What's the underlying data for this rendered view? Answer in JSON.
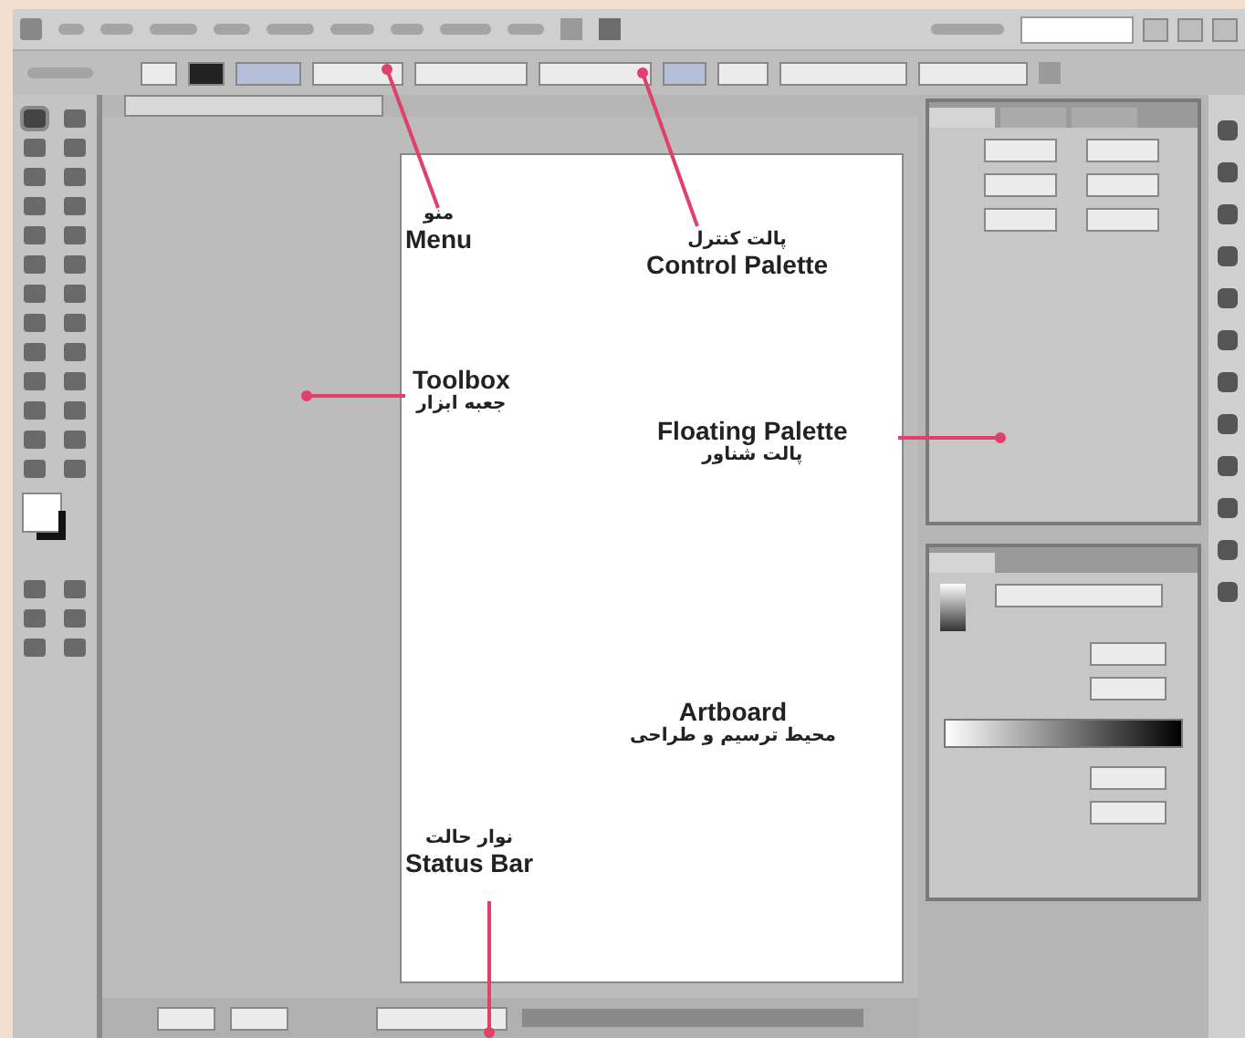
{
  "callouts": [
    {
      "lines": [
        {
          "text": "منو",
          "kind": "persian"
        },
        {
          "text": "Menu",
          "kind": "english"
        }
      ]
    },
    {
      "lines": [
        {
          "text": "پالت کنترل",
          "kind": "persian"
        },
        {
          "text": "Control Palette",
          "kind": "english"
        }
      ]
    },
    {
      "lines": [
        {
          "text": "Toolbox",
          "kind": "english"
        },
        {
          "text": "جعبه ابزار",
          "kind": "persian"
        }
      ]
    },
    {
      "lines": [
        {
          "text": "Floating Palette",
          "kind": "english"
        },
        {
          "text": "پالت شناور",
          "kind": "persian"
        }
      ]
    },
    {
      "lines": [
        {
          "text": "Artboard",
          "kind": "english"
        },
        {
          "text": "محیط ترسیم و طراحی",
          "kind": "persian"
        }
      ]
    },
    {
      "lines": [
        {
          "text": "نوار حالت",
          "kind": "persian"
        },
        {
          "text": "Status Bar",
          "kind": "english"
        }
      ]
    }
  ],
  "floating_panel": {
    "tabs": [
      {
        "selected": true
      },
      {
        "selected": false
      },
      {
        "selected": false
      }
    ]
  },
  "gradient_panel": {
    "tabs": [
      {
        "selected": true
      }
    ]
  }
}
